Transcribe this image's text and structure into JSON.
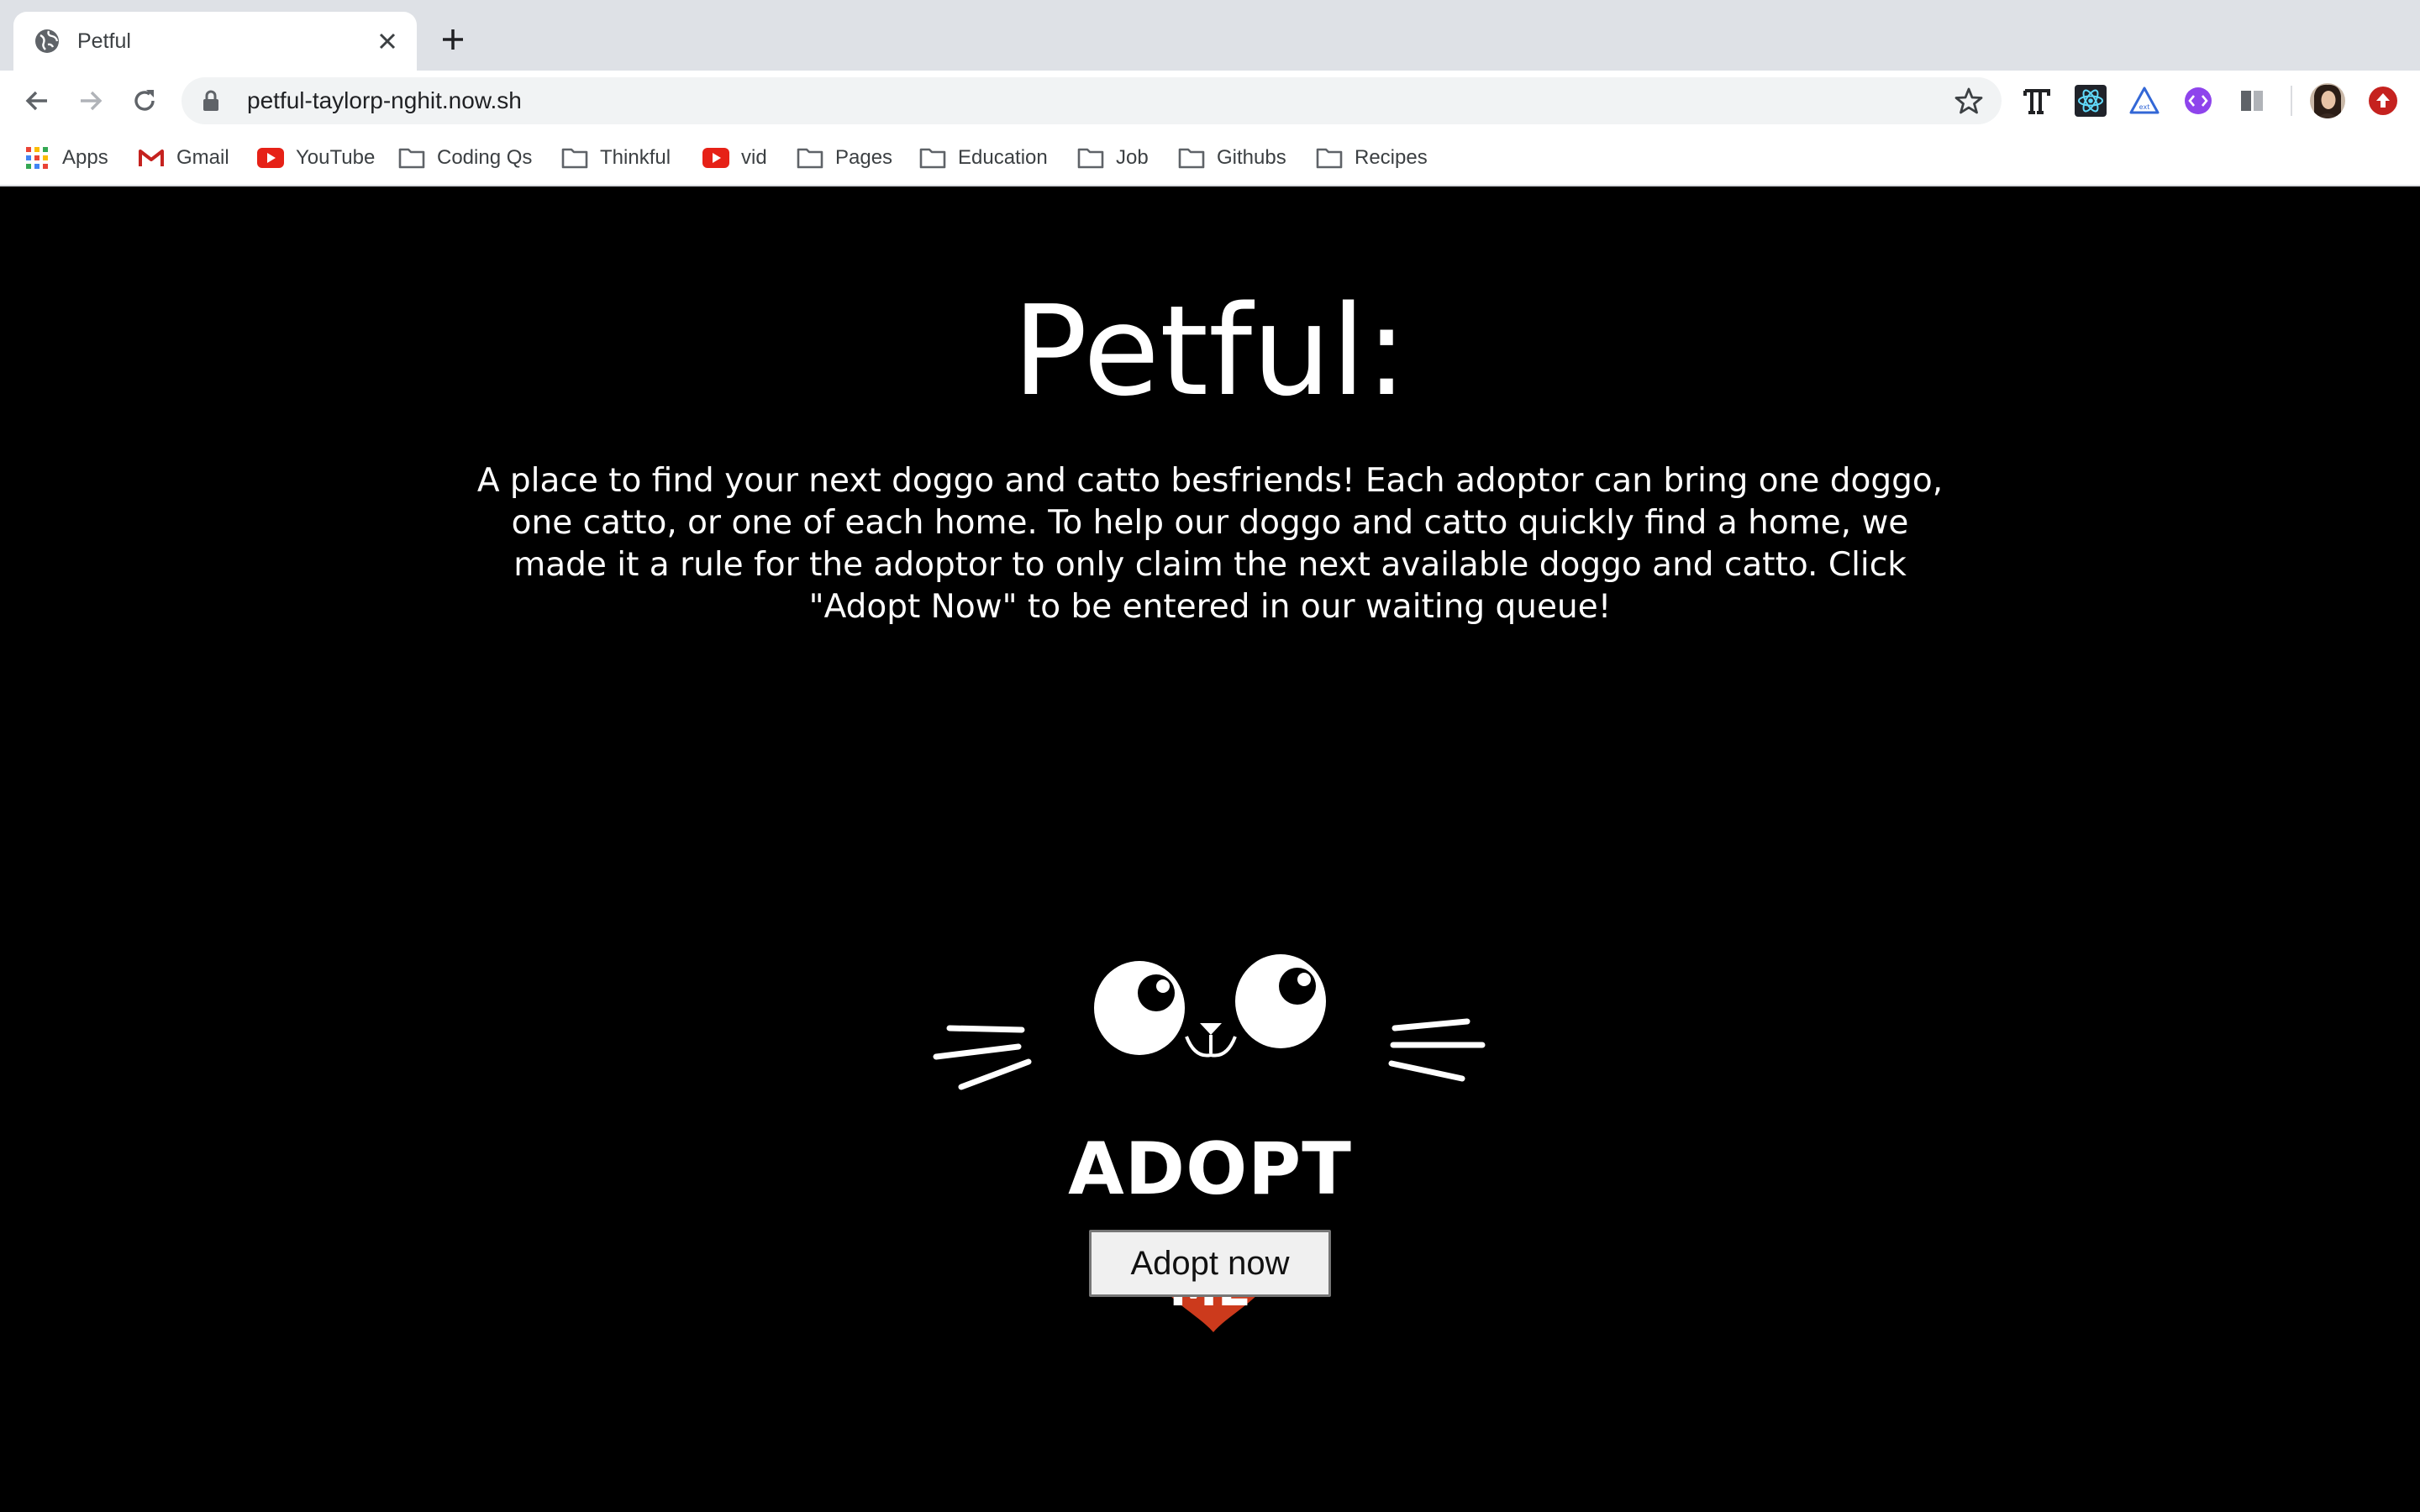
{
  "browser": {
    "tab_title": "Petful",
    "url": "petful-taylorp-nghit.now.sh"
  },
  "bookmarks": [
    {
      "label": "Apps",
      "icon": "apps-grid-icon"
    },
    {
      "label": "Gmail",
      "icon": "gmail-icon"
    },
    {
      "label": "YouTube",
      "icon": "youtube-icon"
    },
    {
      "label": "Coding Qs",
      "icon": "folder-icon"
    },
    {
      "label": "Thinkful",
      "icon": "folder-icon"
    },
    {
      "label": "vid",
      "icon": "youtube-icon"
    },
    {
      "label": "Pages",
      "icon": "folder-icon"
    },
    {
      "label": "Education",
      "icon": "folder-icon"
    },
    {
      "label": "Job",
      "icon": "folder-icon"
    },
    {
      "label": "Githubs",
      "icon": "folder-icon"
    },
    {
      "label": "Recipes",
      "icon": "folder-icon"
    }
  ],
  "extensions": [
    "typography-icon",
    "react-icon",
    "triangle-icon",
    "code-icon",
    "panel-icon",
    "avatar",
    "update-icon"
  ],
  "page": {
    "title": "Petful:",
    "intro": "A place to find your next doggo and catto besfriends! Each adoptor can bring one doggo, one catto, or one of each home. To help our doggo and catto quickly find a home, we made it a rule for the adoptor to only claim the next available doggo and catto. Click \"Adopt Now\" to be entered in our waiting queue!",
    "hero_adopt": "ADOPT",
    "hero_me": "ME",
    "adopt_button": "Adopt now"
  },
  "colors": {
    "page_background": "#000000",
    "heart": "#cc3a1c",
    "chrome_tabstrip": "#dee1e6",
    "omnibox": "#f1f3f4"
  }
}
